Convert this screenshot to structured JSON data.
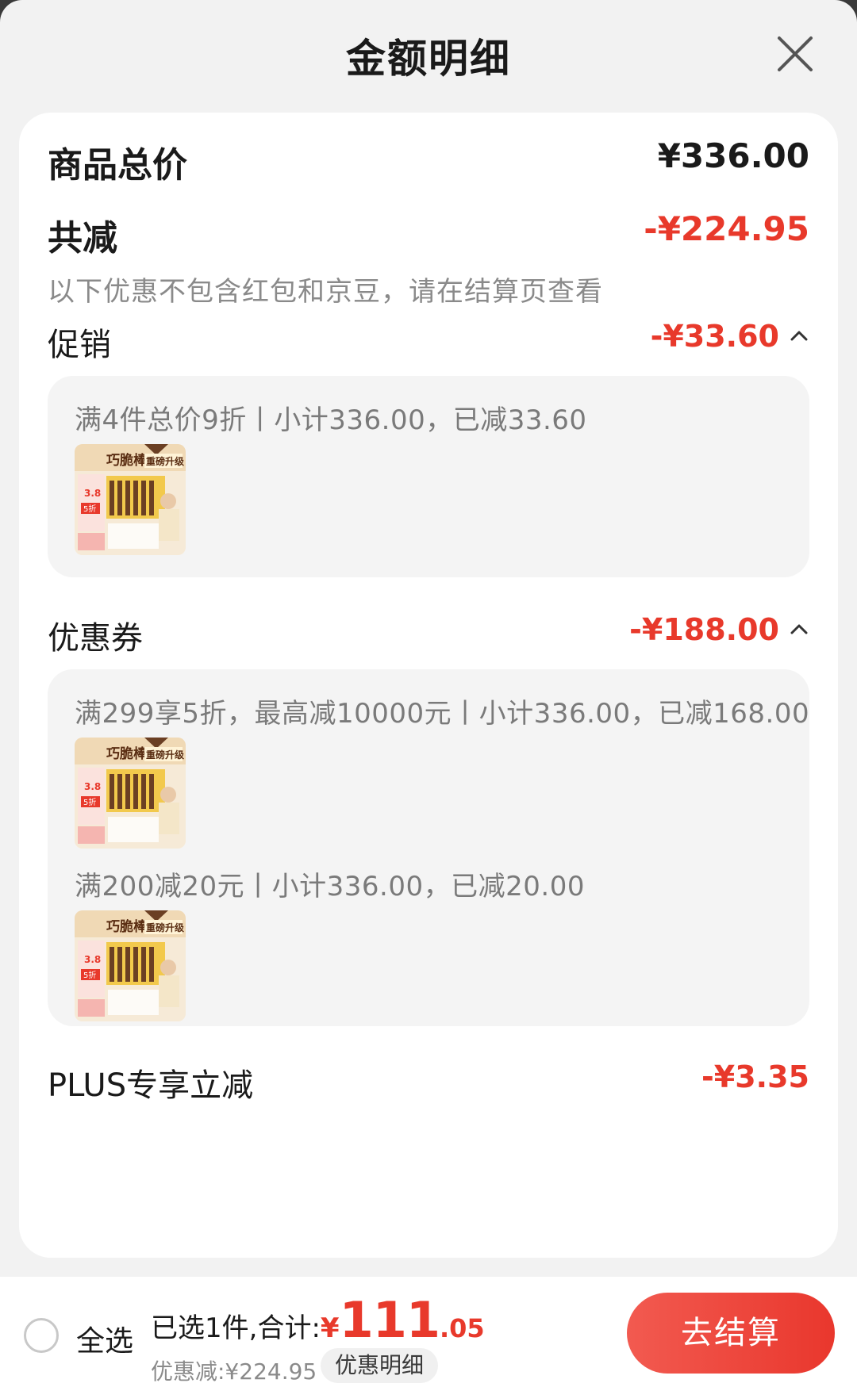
{
  "header": {
    "title": "金额明细"
  },
  "summary": {
    "total_label": "商品总价",
    "total_value": "¥336.00",
    "reduce_label": "共减",
    "reduce_value": "-¥224.95",
    "hint": "以下优惠不包含红包和京豆，请在结算页查看"
  },
  "promotion": {
    "label": "促销",
    "value": "-¥33.60",
    "rule": "满4件总价9折丨小计336.00，已减33.60"
  },
  "coupon": {
    "label": "优惠券",
    "value": "-¥188.00",
    "rules": [
      "满299享5折，最高减10000元丨小计336.00，已减168.00",
      "满200减20元丨小计336.00，已减20.00"
    ]
  },
  "plus": {
    "label": "PLUS专享立减",
    "value": "-¥3.35"
  },
  "product_thumb": {
    "brand_text": "巧脆棒",
    "tag_text": "重磅升级",
    "price_tag": "3.8",
    "badge": "5折"
  },
  "bottom_bar": {
    "select_all": "全选",
    "summary_label": "已选1件,合计:",
    "currency": "¥",
    "total_int": "111",
    "total_dec": ".05",
    "discount_text": "优惠减:¥224.95",
    "detail_button": "优惠明细",
    "checkout_button": "去结算"
  },
  "colors": {
    "accent_red": "#e8392b",
    "page_bg": "#f2f2f2"
  }
}
